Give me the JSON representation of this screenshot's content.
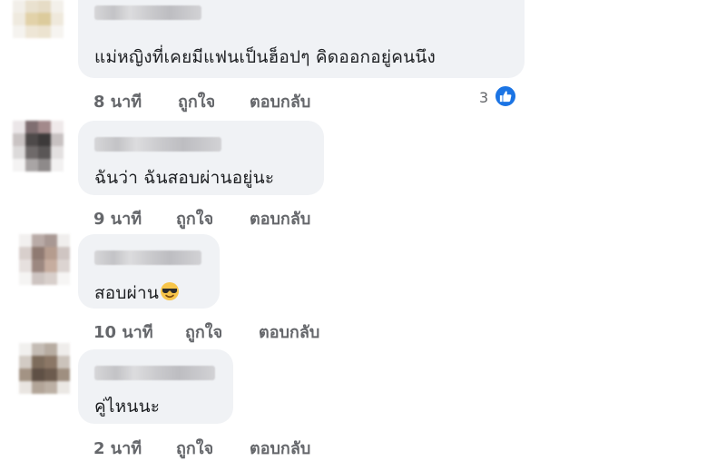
{
  "comments": [
    {
      "text": "แม่หญิงที่เคยมีแฟนเป็นฮ็อปๆ คิดออกอยู่คนนึง",
      "time": "8 นาที",
      "like_label": "ถูกใจ",
      "reply_label": "ตอบกลับ",
      "reaction_count": "3"
    },
    {
      "text": "ฉันว่า ฉันสอบผ่านอยู่นะ",
      "time": "9 นาที",
      "like_label": "ถูกใจ",
      "reply_label": "ตอบกลับ"
    },
    {
      "text": "สอบผ่าน",
      "emoji": "smiling-face-with-sunglasses",
      "time": "10 นาที",
      "like_label": "ถูกใจ",
      "reply_label": "ตอบกลับ"
    },
    {
      "text": "คู่ไหนนะ",
      "time": "2 นาที",
      "like_label": "ถูกใจ",
      "reply_label": "ตอบกลับ"
    }
  ],
  "colors": {
    "bubble": "#f0f2f5",
    "meta_text": "#65676b",
    "like_badge": "#1b74e4"
  }
}
